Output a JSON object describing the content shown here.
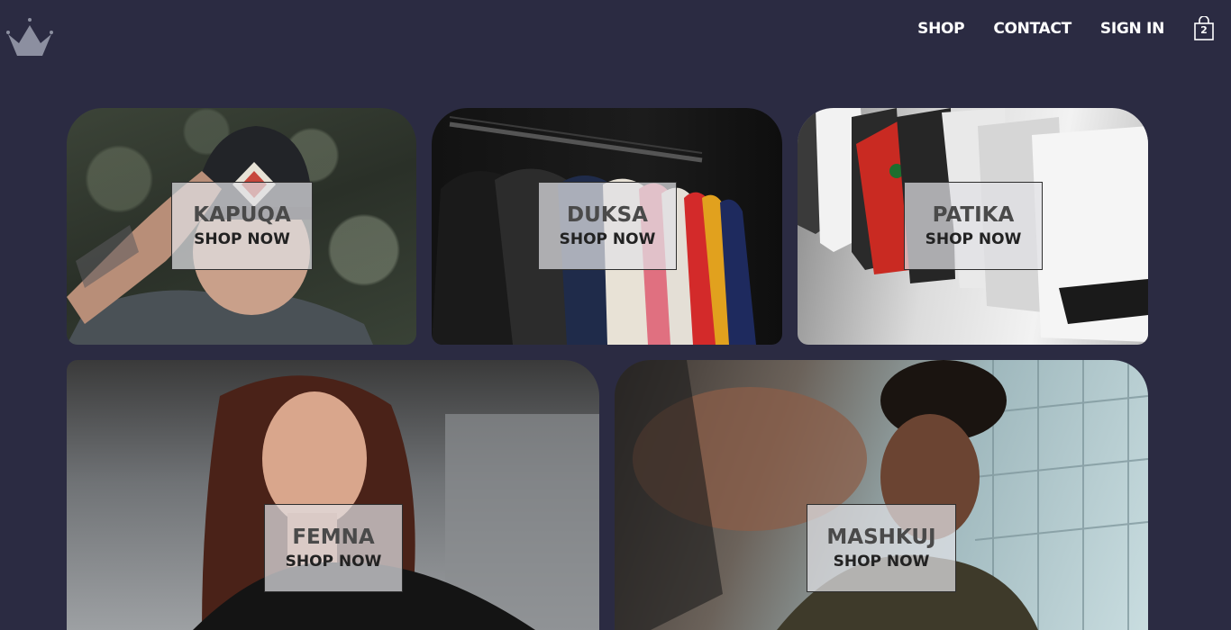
{
  "header": {
    "logo": "crown-logo",
    "nav": [
      {
        "label": "SHOP"
      },
      {
        "label": "CONTACT"
      },
      {
        "label": "SIGN IN"
      }
    ],
    "cart": {
      "icon": "shopping-bag-icon",
      "count": "2"
    }
  },
  "categories": [
    {
      "title": "KAPUQA",
      "action": "SHOP NOW"
    },
    {
      "title": "DUKSA",
      "action": "SHOP NOW"
    },
    {
      "title": "PATIKA",
      "action": "SHOP NOW"
    },
    {
      "title": "FEMNA",
      "action": "SHOP NOW"
    },
    {
      "title": "MASHKUJ",
      "action": "SHOP NOW"
    }
  ],
  "colors": {
    "background": "#2b2b42",
    "nav_text": "#ffffff",
    "label_box": "rgba(225,225,228,0.72)"
  }
}
